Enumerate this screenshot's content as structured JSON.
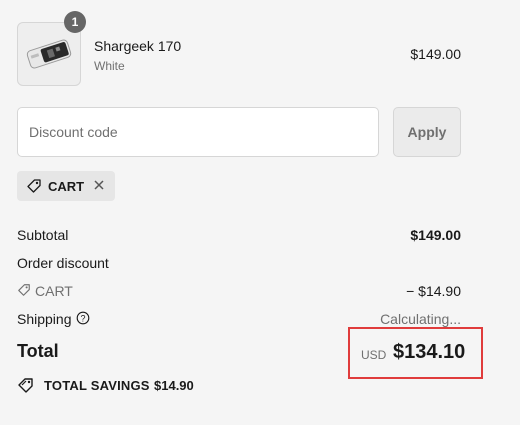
{
  "product": {
    "name": "Shargeek 170",
    "variant": "White",
    "price": "$149.00",
    "quantity": "1",
    "image_alt": "product-image"
  },
  "discount": {
    "placeholder": "Discount code",
    "apply_label": "Apply",
    "applied_code": "CART"
  },
  "summary": {
    "subtotal_label": "Subtotal",
    "subtotal_value": "$149.00",
    "order_discount_label": "Order discount",
    "code_label": "CART",
    "code_value": "− $14.90",
    "shipping_label": "Shipping",
    "shipping_value": "Calculating...",
    "total_label": "Total",
    "currency": "USD",
    "total_value": "$134.10",
    "savings_label": "TOTAL SAVINGS",
    "savings_value": "$14.90"
  },
  "colors": {
    "highlight_border": "#e03c3c",
    "badge": "#666666"
  },
  "icons": [
    "tag-icon",
    "close-icon",
    "info-icon",
    "savings-tag-icon"
  ]
}
